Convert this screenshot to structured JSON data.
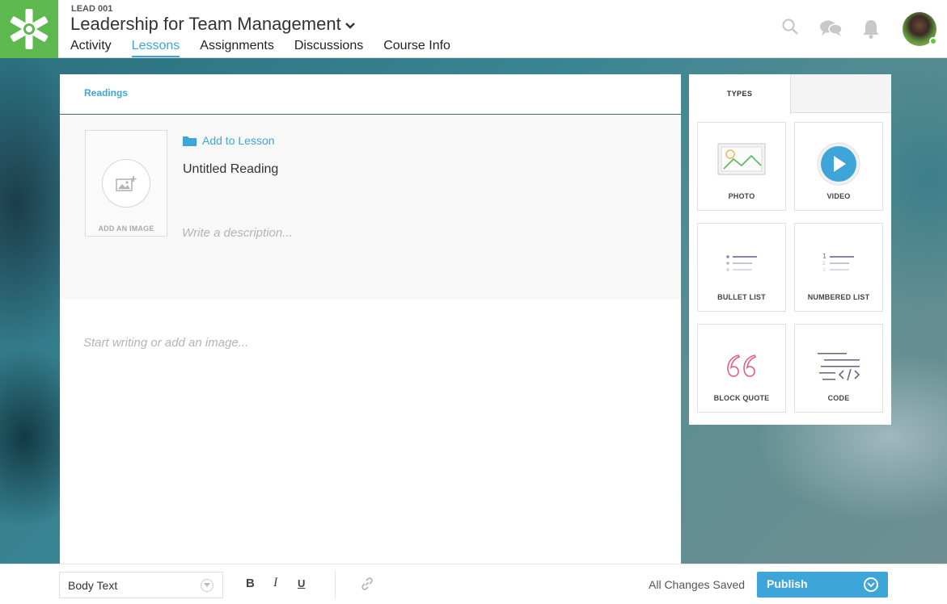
{
  "header": {
    "course_code": "LEAD 001",
    "course_title": "Leadership for Team Management",
    "tabs": [
      {
        "label": "Activity"
      },
      {
        "label": "Lessons",
        "active": true
      },
      {
        "label": "Assignments"
      },
      {
        "label": "Discussions"
      },
      {
        "label": "Course Info"
      }
    ],
    "icons": [
      "search-icon",
      "chat-icon",
      "bell-icon"
    ],
    "brand_color": "#5db84e",
    "accent_color": "#3ea5d8"
  },
  "editor": {
    "tab_label": "Readings",
    "image_drop_label": "ADD AN IMAGE",
    "add_to_lesson": "Add to Lesson",
    "title": "Untitled Reading",
    "description_placeholder": "Write a description...",
    "body_placeholder": "Start writing or add an image..."
  },
  "types_panel": {
    "tab_label": "TYPES",
    "items": [
      {
        "label": "PHOTO",
        "icon": "photo-icon"
      },
      {
        "label": "VIDEO",
        "icon": "video-play-icon"
      },
      {
        "label": "BULLET LIST",
        "icon": "bullet-list-icon"
      },
      {
        "label": "NUMBERED LIST",
        "icon": "numbered-list-icon"
      },
      {
        "label": "BLOCK QUOTE",
        "icon": "quote-icon"
      },
      {
        "label": "CODE",
        "icon": "code-icon"
      }
    ]
  },
  "toolbar": {
    "text_style": "Body Text",
    "bold": "B",
    "italic": "I",
    "underline": "U",
    "save_status": "All Changes Saved",
    "publish_label": "Publish"
  }
}
